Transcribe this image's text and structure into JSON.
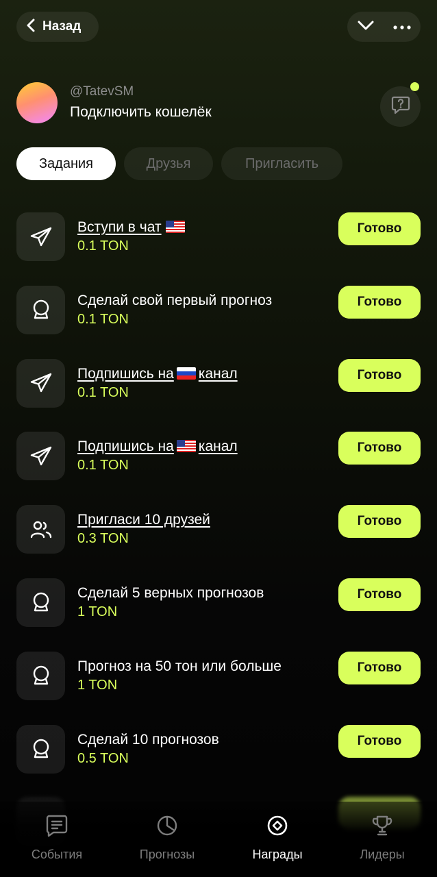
{
  "header": {
    "back_label": "Назад",
    "back_icon": "chevron-left-icon",
    "collapse_icon": "chevron-down-icon",
    "more_icon": "more-dots-icon"
  },
  "profile": {
    "username": "@TatevSM",
    "wallet_label": "Подключить кошелёк",
    "help_icon": "question-bubble-icon"
  },
  "tabs": [
    {
      "label": "Задания",
      "active": true
    },
    {
      "label": "Друзья",
      "active": false
    },
    {
      "label": "Пригласить",
      "active": false
    }
  ],
  "tasks": [
    {
      "title": "Вступи в чат",
      "flag": "us",
      "reward": "0.1 TON",
      "icon": "telegram-icon",
      "button": "Готово"
    },
    {
      "title": "Сделай свой первый прогноз",
      "reward": "0.1 TON",
      "icon": "crystal-ball-icon",
      "button": "Готово"
    },
    {
      "title_before": "Подпишись на",
      "flag": "ru",
      "title_after": "канал",
      "reward": "0.1 TON",
      "icon": "telegram-icon",
      "button": "Готово"
    },
    {
      "title_before": "Подпишись на",
      "flag": "us",
      "title_after": "канал",
      "reward": "0.1 TON",
      "icon": "telegram-icon",
      "button": "Готово"
    },
    {
      "title": "Пригласи 10 друзей",
      "reward": "0.3 TON",
      "icon": "users-icon",
      "button": "Готово"
    },
    {
      "title": "Сделай 5 верных прогнозов",
      "reward": "1 TON",
      "icon": "crystal-ball-icon",
      "button": "Готово"
    },
    {
      "title": "Прогноз на 50 тон или больше",
      "reward": "1 TON",
      "icon": "crystal-ball-icon",
      "button": "Готово"
    },
    {
      "title": "Сделай 10 прогнозов",
      "reward": "0.5 TON",
      "icon": "crystal-ball-icon",
      "button": "Готово"
    }
  ],
  "nav": [
    {
      "label": "События",
      "icon": "message-list-icon",
      "active": false
    },
    {
      "label": "Прогнозы",
      "icon": "clock-icon",
      "active": false
    },
    {
      "label": "Награды",
      "icon": "reward-icon",
      "active": true
    },
    {
      "label": "Лидеры",
      "icon": "trophy-icon",
      "active": false
    }
  ],
  "colors": {
    "accent": "#d9ff5c",
    "background_top": "#1b2210",
    "background_bottom": "#030303",
    "muted_text": "#7d7d7d"
  }
}
